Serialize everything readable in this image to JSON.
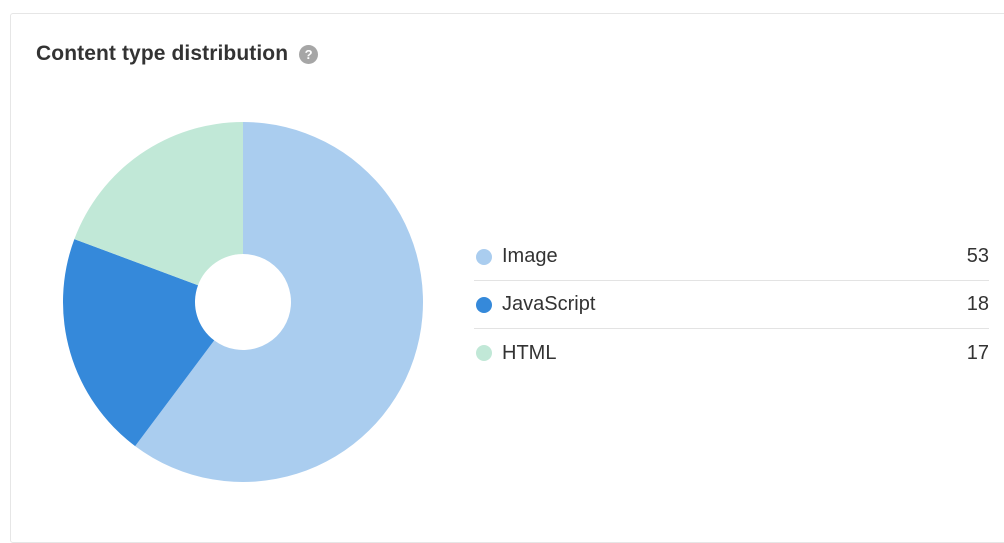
{
  "header": {
    "title": "Content type distribution",
    "help_icon": "question-mark-circle"
  },
  "chart_data": {
    "type": "pie",
    "donut": true,
    "categories": [
      "Image",
      "JavaScript",
      "HTML"
    ],
    "values": [
      53,
      18,
      17
    ],
    "colors": [
      "#aacdef",
      "#3589da",
      "#c1e8d7"
    ],
    "legend_position": "right"
  },
  "legend": {
    "items": [
      {
        "label": "Image",
        "value": "53",
        "color": "#aacdef"
      },
      {
        "label": "JavaScript",
        "value": "18",
        "color": "#3589da"
      },
      {
        "label": "HTML",
        "value": "17",
        "color": "#c1e8d7"
      }
    ]
  }
}
